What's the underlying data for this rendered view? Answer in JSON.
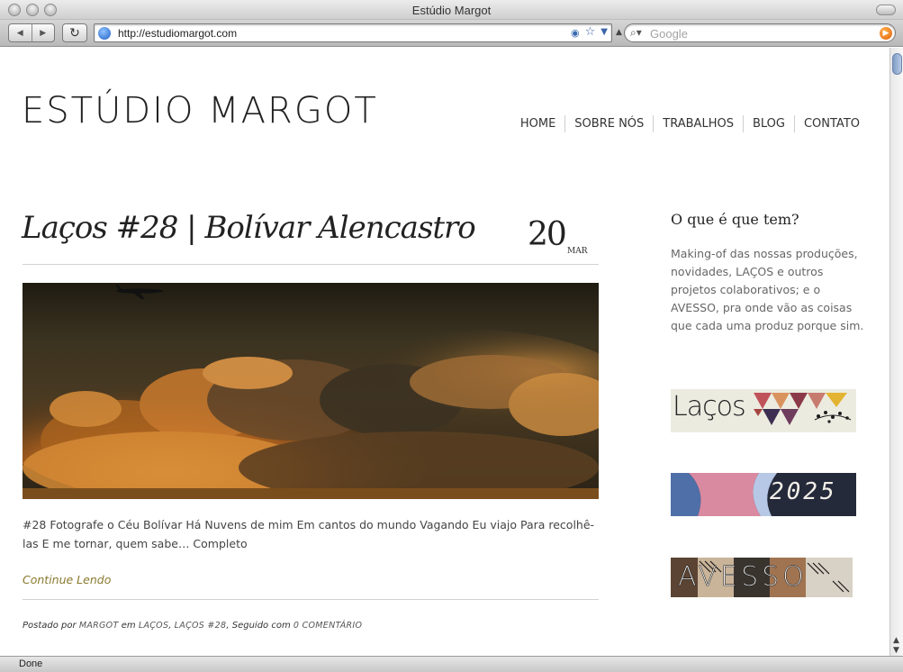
{
  "window": {
    "title": "Estúdio Margot"
  },
  "toolbar": {
    "back_icon": "back-arrow-icon",
    "forward_icon": "forward-arrow-icon",
    "reload_icon": "reload-icon",
    "url": "http://estudiomargot.com",
    "search_placeholder": "Google"
  },
  "status": {
    "text": "Done"
  },
  "site": {
    "logo": "ESTÚDIO MARGOT",
    "nav": [
      "HOME",
      "SOBRE NÓS",
      "TRABALHOS",
      "BLOG",
      "CONTATO"
    ]
  },
  "post": {
    "title": "Laços #28 | Bolívar Alencastro",
    "date_day": "20",
    "date_month": "MAR",
    "excerpt": "#28 Fotografe o Céu Bolívar Há Nuvens de mim Em cantos do mundo Vagando Eu viajo Para recolhê-las E me tornar, quem sabe… Completo",
    "continue_label": "Continue Lendo",
    "meta": {
      "posted_by": "Postado por",
      "author": "MARGOT",
      "in_label": "em",
      "category1": "LAÇOS",
      "category2": "LAÇOS #28",
      "followed_label": "Seguido com",
      "comments": "0 COMENTÁRIO"
    }
  },
  "sidebar": {
    "title": "O que é que tem?",
    "text": "Making-of das nossas produções, novidades, LAÇOS e outros projetos colaborativos; e o AVESSO, pra onde vão as coisas que cada uma produz porque sim.",
    "banners": {
      "lacos": "Laços",
      "year": "2025",
      "avesso": "AVESSO"
    }
  },
  "colors": {
    "accent_link": "#8a7a2f",
    "text": "#444444",
    "rule": "#d2d2d2"
  }
}
